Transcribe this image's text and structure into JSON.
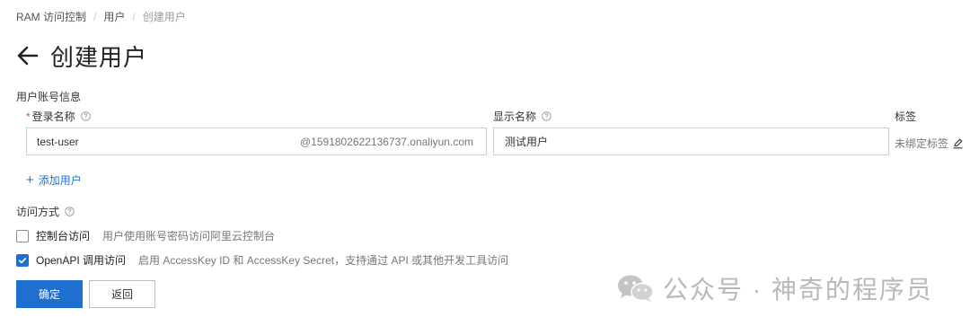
{
  "breadcrumb": {
    "items": [
      "RAM 访问控制",
      "用户",
      "创建用户"
    ],
    "separator": "/"
  },
  "page": {
    "title": "创建用户"
  },
  "account_section": {
    "title": "用户账号信息"
  },
  "login_name": {
    "required_mark": "*",
    "label": "登录名称",
    "value": "test-user",
    "suffix": "@1591802622136737.onaliyun.com"
  },
  "display_name": {
    "label": "显示名称",
    "value": "测试用户"
  },
  "tags": {
    "label": "标签",
    "value": "未绑定标签"
  },
  "add_user": {
    "plus": "+",
    "label": "添加用户"
  },
  "access_section": {
    "title": "访问方式"
  },
  "access_options": [
    {
      "label": "控制台访问",
      "description": "用户使用账号密码访问阿里云控制台",
      "checked": false
    },
    {
      "label": "OpenAPI 调用访问",
      "description": "启用 AccessKey ID 和 AccessKey Secret，支持通过 API 或其他开发工具访问",
      "checked": true
    }
  ],
  "buttons": {
    "confirm": "确定",
    "back": "返回"
  },
  "watermark": {
    "text": "公众号 · 神奇的程序员"
  },
  "colors": {
    "primary": "#1f6fd1",
    "required": "#e5484d"
  }
}
